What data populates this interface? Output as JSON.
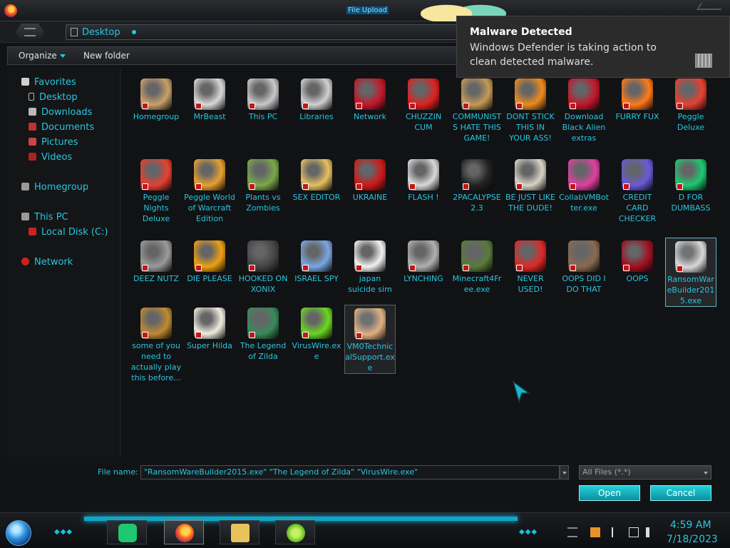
{
  "window": {
    "title": "File Upload"
  },
  "address": {
    "path": "Desktop"
  },
  "toolbar": {
    "organize_label": "Organize",
    "new_folder_label": "New folder"
  },
  "navigation": {
    "favorites": "Favorites",
    "favorite_items": [
      "Desktop",
      "Downloads",
      "Documents",
      "Pictures",
      "Videos"
    ],
    "homegroup": "Homegroup",
    "this_pc": "This PC",
    "local_disk": "Local Disk (C:)",
    "network": "Network"
  },
  "files": [
    {
      "label": "Homegroup",
      "icon": "house-icon",
      "color": "#c9a06a"
    },
    {
      "label": "MrBeast",
      "icon": "chess-piece-icon",
      "color": "#d8d8d8"
    },
    {
      "label": "This PC",
      "icon": "computer-icon",
      "color": "#c9c9c9"
    },
    {
      "label": "Libraries",
      "icon": "chess-piece-icon",
      "color": "#d0d0d0"
    },
    {
      "label": "Network",
      "icon": "red-orb-icon",
      "color": "#c4162a"
    },
    {
      "label": "CHUZZIN CUM",
      "icon": "red-fuzzball-icon",
      "color": "#e02020"
    },
    {
      "label": "COMMUNISTS HATE THIS GAME!",
      "icon": "money-bag-icon",
      "color": "#c49a55"
    },
    {
      "label": "DONT STICK THIS IN YOUR ASS!",
      "icon": "traffic-cone-icon",
      "color": "#f08a1a"
    },
    {
      "label": "Download Black Alien extras",
      "icon": "red-orb-icon",
      "color": "#c4162a"
    },
    {
      "label": "FURRY FUX",
      "icon": "firefox-icon",
      "color": "#ff7a18"
    },
    {
      "label": "Peggle Deluxe",
      "icon": "peggle-icon",
      "color": "#e84030"
    },
    {
      "label": "Peggle Nights Deluxe",
      "icon": "peggle-icon",
      "color": "#e84030"
    },
    {
      "label": "Peggle World of Warcraft Edition",
      "icon": "peggle-icon",
      "color": "#e8a030"
    },
    {
      "label": "Plants vs Zombies",
      "icon": "plant-icon",
      "color": "#7aa84a"
    },
    {
      "label": "SEX EDITOR",
      "icon": "hxd-icon",
      "color": "#e6c060"
    },
    {
      "label": "UKRAINE",
      "icon": "radiation-icon",
      "color": "#d01818"
    },
    {
      "label": "FLASH !",
      "icon": "flash-icon",
      "color": "#d9d9d9"
    },
    {
      "label": "2PACALYPSE 2.3",
      "icon": "terminal-icon",
      "color": "#222222"
    },
    {
      "label": "BE JUST LIKE THE DUDE!",
      "icon": "santa-icon",
      "color": "#d9d2c5"
    },
    {
      "label": "CollabVMBotter.exe",
      "icon": "monitor-icon",
      "color": "#e040a0"
    },
    {
      "label": "CREDIT CARD CHECKER",
      "icon": "credit-card-icon",
      "color": "#6a5ad8"
    },
    {
      "label": "D FOR DUMBASS",
      "icon": "chat-bubble-icon",
      "color": "#1ec870"
    },
    {
      "label": "DEEZ NUTZ",
      "icon": "windows-stack-icon",
      "color": "#9a9a9a"
    },
    {
      "label": "DIE PLEASE",
      "icon": "de-icon",
      "color": "#f0a010"
    },
    {
      "label": "HOOKED ON XONIX",
      "icon": "xonix-icon",
      "color": "#444444"
    },
    {
      "label": "ISRAEL SPY",
      "icon": "network-share-icon",
      "color": "#7aa6e0"
    },
    {
      "label": "japan suicide sim",
      "icon": "document-icon",
      "color": "#f2f2f2"
    },
    {
      "label": "LYNCHING",
      "icon": "rope-icon",
      "color": "#b0b0b0"
    },
    {
      "label": "Minecraft4Free.exe",
      "icon": "grass-block-icon",
      "color": "#5a7a3a"
    },
    {
      "label": "NEVER USED!",
      "icon": "devcpp-icon",
      "color": "#e02828"
    },
    {
      "label": "OOPS DID I DO THAT",
      "icon": "portrait-icon",
      "color": "#8a6a50"
    },
    {
      "label": "OOPS",
      "icon": "red-orb-icon",
      "color": "#a01020"
    },
    {
      "label": "RansomWareBuilder2015.exe",
      "icon": "skull-icon",
      "color": "#d8d8d8"
    },
    {
      "label": "some of you need to actually play this before...",
      "icon": "cartoon-dog-icon",
      "color": "#c08a30"
    },
    {
      "label": "Super Hilda",
      "icon": "pixel-cat-icon",
      "color": "#f0ece0"
    },
    {
      "label": "The Legend of Zilda",
      "icon": "pixel-hero-icon",
      "color": "#3a8a5a"
    },
    {
      "label": "VirusWire.exe",
      "icon": "limewire-icon",
      "color": "#6ad820"
    },
    {
      "label": "VM0TechnicalSupport.exe",
      "icon": "doctor-icon",
      "color": "#e0b080"
    }
  ],
  "dialog": {
    "filename_label": "File name:",
    "filename_value": "\"RansomWareBuilder2015.exe\" \"The Legend of Zilda\" \"VirusWire.exe\"",
    "filter_value": "All Files (*.*)",
    "open_label": "Open",
    "cancel_label": "Cancel"
  },
  "notification": {
    "title": "Malware Detected",
    "body": "Windows Defender is taking action to clean detected malware."
  },
  "taskbar": {
    "time": "4:59 AM",
    "date": "7/18/2023"
  }
}
